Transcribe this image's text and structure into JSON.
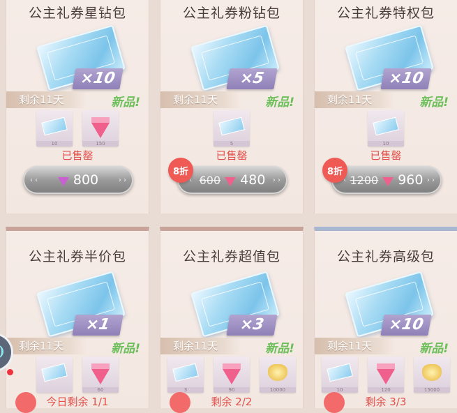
{
  "packs": [
    {
      "title": "公主礼券星钻包",
      "multiplier": "×10",
      "remaining": "剩余11天",
      "new_tag": "新品!",
      "items": [
        {
          "icon": "ticket-icon",
          "qty": "10"
        },
        {
          "icon": "gem-icon",
          "qty": "150"
        }
      ],
      "status": "已售罄",
      "discount": "",
      "price_old": "",
      "price": "800",
      "gem_color": "#c95fd0"
    },
    {
      "title": "公主礼券粉钻包",
      "multiplier": "×5",
      "remaining": "剩余11天",
      "new_tag": "新品!",
      "items": [
        {
          "icon": "ticket-icon",
          "qty": "5"
        }
      ],
      "status": "已售罄",
      "discount": "8折",
      "price_old": "600",
      "price": "480",
      "gem_color": "#f0608d"
    },
    {
      "title": "公主礼券特权包",
      "multiplier": "×10",
      "remaining": "剩余11天",
      "new_tag": "新品!",
      "items": [
        {
          "icon": "ticket-icon",
          "qty": "10"
        }
      ],
      "status": "已售罄",
      "discount": "8折",
      "price_old": "1200",
      "price": "960",
      "gem_color": "#f0608d"
    },
    {
      "title": "公主礼券半价包",
      "multiplier": "×1",
      "remaining": "剩余11天",
      "new_tag": "新品!",
      "items": [
        {
          "icon": "ticket-icon",
          "qty": ""
        },
        {
          "icon": "gem-icon",
          "qty": "60"
        }
      ],
      "status": "今日剩余 1/1"
    },
    {
      "title": "公主礼券超值包",
      "multiplier": "×3",
      "remaining": "剩余11天",
      "new_tag": "新品!",
      "items": [
        {
          "icon": "ticket-icon",
          "qty": "3"
        },
        {
          "icon": "gem-icon",
          "qty": "90"
        },
        {
          "icon": "gold-icon",
          "qty": "10000"
        }
      ],
      "status": "剩余 2/2"
    },
    {
      "title": "公主礼券高级包",
      "multiplier": "×10",
      "remaining": "剩余11天",
      "new_tag": "新品!",
      "items": [
        {
          "icon": "ticket-icon",
          "qty": "10"
        },
        {
          "icon": "gem-icon",
          "qty": "120"
        },
        {
          "icon": "gold-icon",
          "qty": "15000"
        }
      ],
      "status": "剩余 3/3"
    }
  ]
}
